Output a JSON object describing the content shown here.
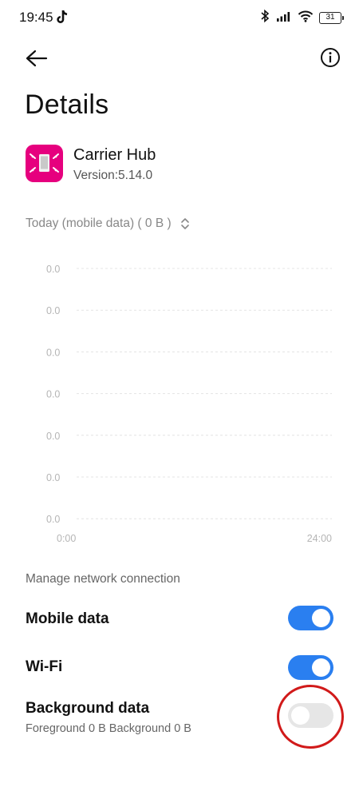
{
  "status_bar": {
    "time": "19:45",
    "battery": "31"
  },
  "page": {
    "title": "Details"
  },
  "app": {
    "name": "Carrier Hub",
    "version": "Version:5.14.0",
    "icon_color": "#e6007e"
  },
  "usage": {
    "selector_label": "Today (mobile data) ( 0 B )"
  },
  "chart_data": {
    "type": "area",
    "y_tick_labels": [
      "0.0",
      "0.0",
      "0.0",
      "0.0",
      "0.0",
      "0.0",
      "0.0"
    ],
    "x_tick_labels": [
      "0:00",
      "24:00"
    ],
    "values": [],
    "grid": true
  },
  "network": {
    "section_label": "Manage network connection",
    "items": [
      {
        "label": "Mobile data",
        "enabled": true
      },
      {
        "label": "Wi-Fi",
        "enabled": true
      },
      {
        "label": "Background data",
        "sublabel": "Foreground 0 B  Background 0 B",
        "enabled": false
      }
    ]
  },
  "colors": {
    "accent": "#2a7ff0",
    "toggle_off": "#e6e6e6",
    "annotation": "#d11a1a"
  }
}
